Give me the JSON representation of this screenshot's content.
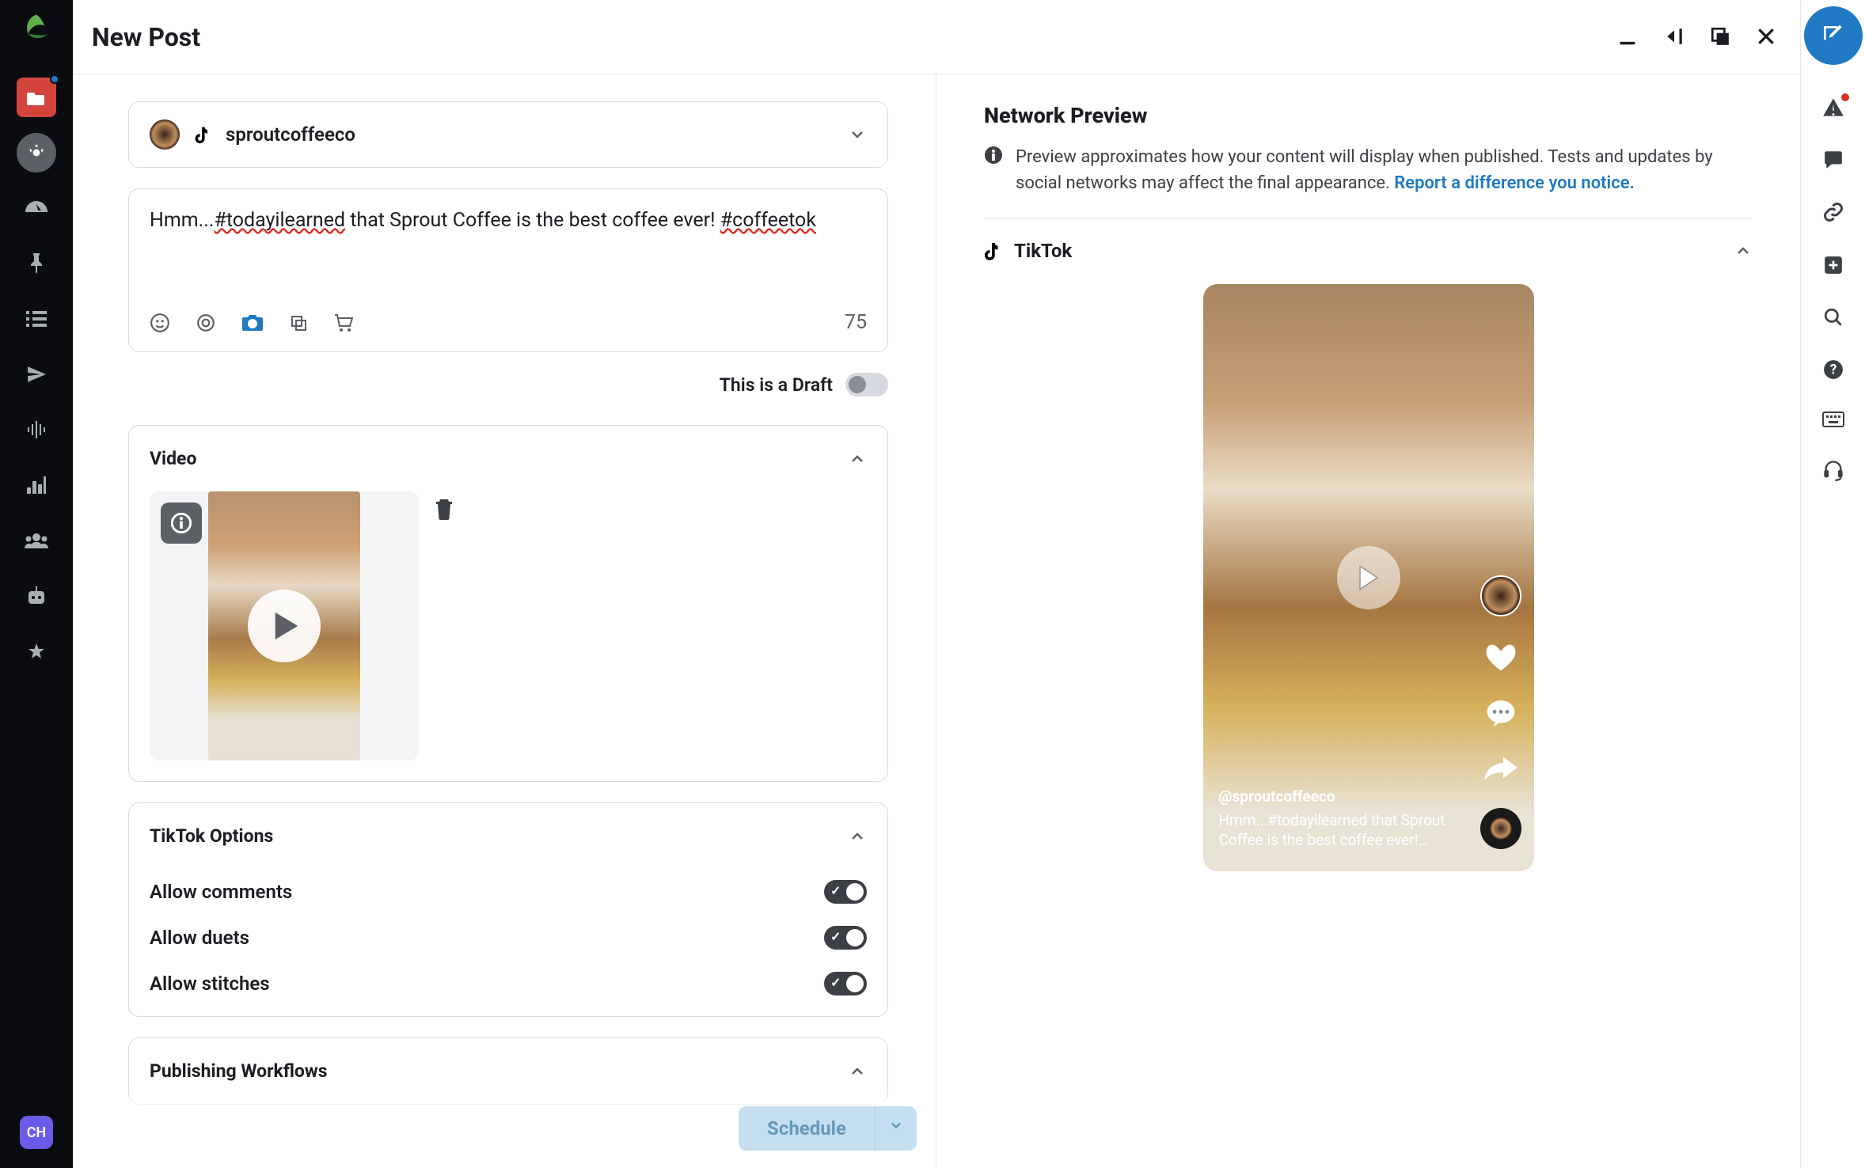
{
  "titlebar": {
    "title": "New Post"
  },
  "profile": {
    "handle": "sproutcoffeeco"
  },
  "composer": {
    "text_leading": "Hmm...",
    "hashtag1": "#todayilearned",
    "text_mid": " that Sprout Coffee is the best coffee ever! ",
    "hashtag2": "#coffeetok",
    "char_count": "75"
  },
  "draft": {
    "label": "This is a Draft"
  },
  "video": {
    "header": "Video"
  },
  "tiktok_options": {
    "header": "TikTok Options",
    "allow_comments": "Allow comments",
    "allow_duets": "Allow duets",
    "allow_stitches": "Allow stitches"
  },
  "workflows": {
    "header": "Publishing Workflows"
  },
  "schedule": {
    "label": "Schedule"
  },
  "preview": {
    "header": "Network Preview",
    "note": "Preview approximates how your content will display when published. Tests and updates by social networks may affect the final appearance. ",
    "report_link": "Report a difference you notice.",
    "network": "TikTok",
    "handle": "@sproutcoffeeco",
    "caption": "Hmm...#todayilearned that Sprout Coffee is the best coffee ever!…"
  },
  "user": {
    "initials": "CH"
  }
}
